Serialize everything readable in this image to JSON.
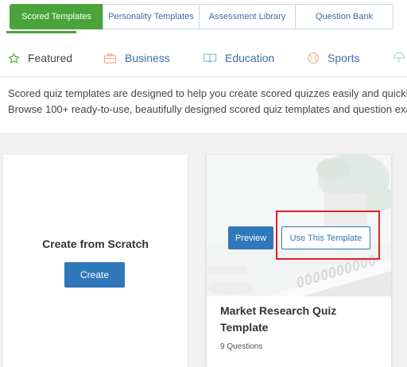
{
  "top_tabs": [
    {
      "label": "Scored Templates"
    },
    {
      "label": "Personality Templates"
    },
    {
      "label": "Assessment Library"
    },
    {
      "label": "Question Bank"
    }
  ],
  "category_tabs": [
    {
      "label": "Featured",
      "icon": "star-outline-icon"
    },
    {
      "label": "Business",
      "icon": "briefcase-icon"
    },
    {
      "label": "Education",
      "icon": "book-icon"
    },
    {
      "label": "Sports",
      "icon": "ball-icon"
    }
  ],
  "description": {
    "line1": "Scored quiz templates are designed to help you create scored quizzes easily and quickly",
    "line2": "Browse 100+ ready-to-use, beautifully designed scored quiz templates and question exa"
  },
  "scratch_card": {
    "title": "Create from Scratch",
    "button": "Create"
  },
  "template_card": {
    "preview_button": "Preview",
    "use_button": "Use This Template",
    "title": "Market Research Quiz Template",
    "meta": "9 Questions"
  },
  "colors": {
    "accent_green": "#4aa43a",
    "link_blue": "#3a6ea8",
    "button_blue": "#2f78b9",
    "highlight_red": "#e01f26"
  }
}
